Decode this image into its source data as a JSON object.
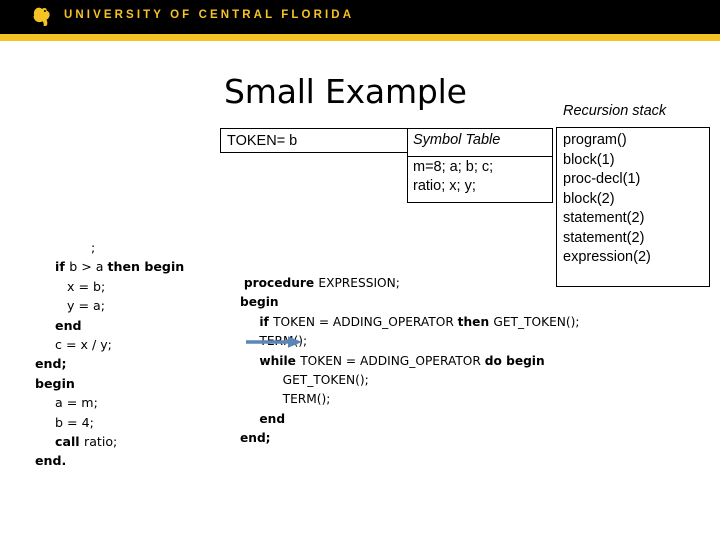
{
  "header": {
    "wordmark": "UNIVERSITY OF CENTRAL FLORIDA",
    "logo_icon": "ucf-pegasus-icon",
    "bar_color": "#f6c324",
    "background_color": "#000000"
  },
  "slide": {
    "title": "Small Example"
  },
  "token": {
    "label": "TOKEN= b"
  },
  "symbol_table": {
    "header": "Symbol Table",
    "rows": [
      "m=8; a; b; c;",
      "ratio; x; y;"
    ]
  },
  "recursion_stack": {
    "caption": "Recursion stack",
    "entries": [
      "program()",
      "block(1)",
      "proc-decl(1)",
      "block(2)",
      "statement(2)",
      "statement(2)",
      "expression(2)"
    ]
  },
  "source_code": {
    "lines": [
      {
        "indent": 14,
        "segments": [
          {
            "text": ";",
            "bold": false
          }
        ]
      },
      {
        "indent": 5,
        "segments": [
          {
            "text": "if ",
            "bold": true
          },
          {
            "text": "b > a ",
            "bold": false
          },
          {
            "text": "then begin",
            "bold": true
          }
        ]
      },
      {
        "indent": 8,
        "segments": [
          {
            "text": "x = b;",
            "bold": false
          }
        ]
      },
      {
        "indent": 8,
        "segments": [
          {
            "text": "y = a;",
            "bold": false
          }
        ]
      },
      {
        "indent": 5,
        "segments": [
          {
            "text": "end",
            "bold": true
          }
        ]
      },
      {
        "indent": 5,
        "segments": [
          {
            "text": "c = x / y;",
            "bold": false
          }
        ]
      },
      {
        "indent": 0,
        "segments": [
          {
            "text": "end;",
            "bold": true
          }
        ]
      },
      {
        "indent": 0,
        "segments": [
          {
            "text": "begin",
            "bold": true
          }
        ]
      },
      {
        "indent": 5,
        "segments": [
          {
            "text": "a = m;",
            "bold": false
          }
        ]
      },
      {
        "indent": 5,
        "segments": [
          {
            "text": "b = 4;",
            "bold": false
          }
        ]
      },
      {
        "indent": 5,
        "segments": [
          {
            "text": "call ",
            "bold": true
          },
          {
            "text": "ratio;",
            "bold": false
          }
        ]
      },
      {
        "indent": 0,
        "segments": [
          {
            "text": "end.",
            "bold": true
          }
        ]
      }
    ]
  },
  "procedure_code": {
    "lines": [
      {
        "indent": 1,
        "segments": [
          {
            "text": "procedure ",
            "bold": true
          },
          {
            "text": "EXPRESSION;",
            "bold": false
          }
        ]
      },
      {
        "indent": 0,
        "segments": [
          {
            "text": "begin",
            "bold": true
          }
        ]
      },
      {
        "indent": 5,
        "segments": [
          {
            "text": "if ",
            "bold": true
          },
          {
            "text": "TOKEN = ADDING_OPERATOR ",
            "bold": false
          },
          {
            "text": "then ",
            "bold": true
          },
          {
            "text": "GET_TOKEN();",
            "bold": false
          }
        ]
      },
      {
        "indent": 5,
        "segments": [
          {
            "text": "TERM();",
            "bold": false
          }
        ]
      },
      {
        "indent": 5,
        "segments": [
          {
            "text": "while ",
            "bold": true
          },
          {
            "text": "TOKEN = ADDING_OPERATOR ",
            "bold": false
          },
          {
            "text": "do begin",
            "bold": true
          }
        ]
      },
      {
        "indent": 11,
        "segments": [
          {
            "text": "GET_TOKEN();",
            "bold": false
          }
        ]
      },
      {
        "indent": 11,
        "segments": [
          {
            "text": "TERM();",
            "bold": false
          }
        ]
      },
      {
        "indent": 5,
        "segments": [
          {
            "text": "end",
            "bold": true
          }
        ]
      },
      {
        "indent": 0,
        "segments": [
          {
            "text": "end;",
            "bold": true
          }
        ]
      }
    ]
  },
  "pointer_arrow": {
    "icon": "right-arrow-icon",
    "color": "#5b87b5",
    "points_to": "TERM();"
  }
}
